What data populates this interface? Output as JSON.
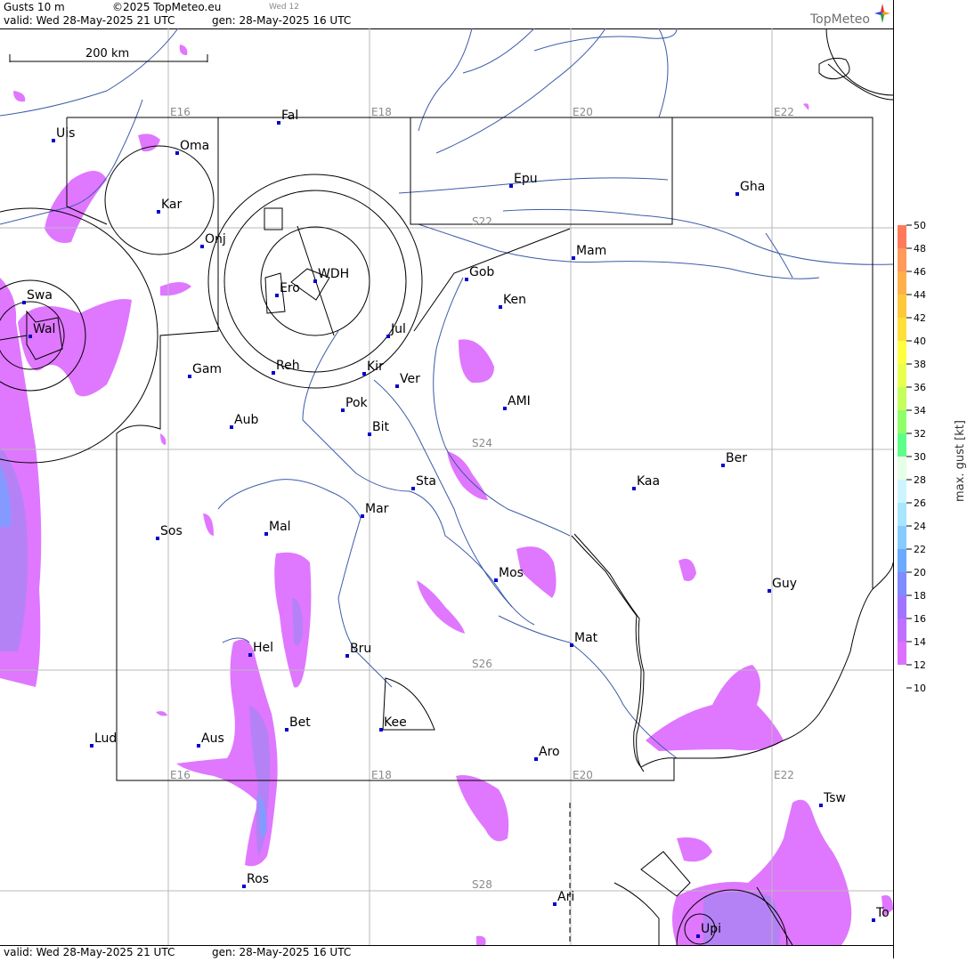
{
  "header": {
    "product": "Gusts 10 m",
    "copyright": "©2025 TopMeteo.eu",
    "day_badge": "Wed 12",
    "valid_line": "valid:  Wed  28-May-2025  21 UTC",
    "gen_line": "gen: 28-May-2025 16 UTC",
    "logo": "TopMeteo"
  },
  "footer": {
    "valid_line": "valid:  Wed  28-May-2025  21 UTC",
    "gen_line": "gen: 28-May-2025 16 UTC"
  },
  "scale_bar": {
    "label": "200 km"
  },
  "grid_labels": {
    "lon_top": [
      "E16",
      "E18",
      "E20",
      "E22"
    ],
    "lon_bottom": [
      "E16",
      "E18",
      "E20",
      "E22"
    ],
    "lat": [
      "S22",
      "S24",
      "S26",
      "S28"
    ]
  },
  "places": [
    "Uis",
    "Fal",
    "Oma",
    "Kar",
    "Onj",
    "Epu",
    "Gha",
    "Mam",
    "Gob",
    "WDH",
    "Ero",
    "Ken",
    "Swa",
    "Wal",
    "Jul",
    "Gam",
    "Reh",
    "Kir",
    "Ver",
    "AMI",
    "Pok",
    "Aub",
    "Bit",
    "Ber",
    "Sta",
    "Kaa",
    "Mar",
    "Sos",
    "Mal",
    "Mos",
    "Guy",
    "Mat",
    "Hel",
    "Bru",
    "Bet",
    "Kee",
    "Lud",
    "Aus",
    "Aro",
    "Tsw",
    "Ros",
    "Ari",
    "Upi",
    "To"
  ],
  "legend": {
    "title": "max. gust [kt]",
    "ticks": [
      "50",
      "48",
      "46",
      "44",
      "42",
      "40",
      "38",
      "36",
      "34",
      "32",
      "30",
      "28",
      "26",
      "24",
      "22",
      "20",
      "18",
      "16",
      "14",
      "12",
      "10"
    ],
    "colors": [
      "#ff7a5a",
      "#ff9a5a",
      "#ffb04a",
      "#ffc83c",
      "#ffe03a",
      "#ffff40",
      "#e8ff50",
      "#c4ff5c",
      "#90ff6a",
      "#5eff88",
      "#e6ffe6",
      "#ccf5ff",
      "#a8e6ff",
      "#88ccff",
      "#6aaaff",
      "#7f8bff",
      "#a074ff",
      "#c070ff",
      "#de70ff",
      "#ffffff"
    ]
  },
  "colors": {
    "grid": "#b8b8b8",
    "river": "#3c5aa8",
    "border": "#000000",
    "town": "#0000cc",
    "gust_low": "#e07af0",
    "gust_mid": "#b880f5",
    "gust_high": "#7f95ff"
  }
}
